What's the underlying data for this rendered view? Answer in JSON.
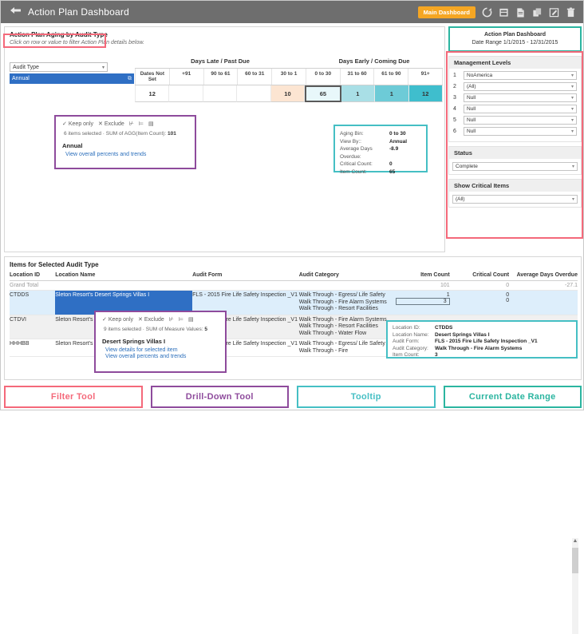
{
  "header": {
    "title": "Action Plan Dashboard",
    "back_icon": "back-arrow-icon",
    "main_dashboard_label": "Main Dashboard",
    "icons": [
      "refresh-icon",
      "save-icon",
      "document-icon",
      "share-icon",
      "edit-icon",
      "trash-icon"
    ]
  },
  "upper": {
    "title": "Action Plan Aging by Audit Type",
    "subtitle": "Click on row or value to filter Action Plan details below.",
    "audit_type_filter": "Audit Type",
    "selected_row": "Annual",
    "group_left": "Days Late / Past Due",
    "group_right": "Days Early / Coming Due",
    "columns": [
      "Dates Not Set",
      "+91",
      "90 to 61",
      "60 to 31",
      "30 to 1",
      "0 to 30",
      "31 to 60",
      "61 to 90",
      "91+"
    ],
    "values": [
      "12",
      "",
      "",
      "",
      "10",
      "65",
      "1",
      "1",
      "12"
    ],
    "cell_colors": [
      "#ffffff",
      "#ffffff",
      "#ffffff",
      "#ffffff",
      "#fce5d2",
      "#e8f7fa",
      "#a9dfe6",
      "#6dcbd7",
      "#3fbecd"
    ],
    "selected_index": 5
  },
  "drill_upper": {
    "keep_only": "Keep only",
    "exclude": "Exclude",
    "meta_prefix": "6 items selected  ·  SUM of AGG(Item Count): ",
    "meta_value": "101",
    "name": "Annual",
    "link": "View overall percents and trends",
    "icons": [
      "keep-only-check-icon",
      "exclude-x-icon",
      "sort-ascending-icon",
      "sort-descending-icon",
      "view-data-icon"
    ]
  },
  "tooltip_upper": {
    "rows": [
      {
        "key": "Aging Bin:",
        "value": "0 to 30"
      },
      {
        "key": "View By::",
        "value": "Annual"
      },
      {
        "key": "Average Days Overdue:",
        "value": "-8.9"
      },
      {
        "key": "Critical Count:",
        "value": "0"
      },
      {
        "key": "Item Count:",
        "value": "65"
      }
    ]
  },
  "right_panel": {
    "date_title": "Action Plan Dashboard",
    "date_range": "Date Range 1/1/2015 - 12/31/2015",
    "management_levels_title": "Management Levels",
    "levels": [
      {
        "num": "1",
        "value": "NoAmerica"
      },
      {
        "num": "2",
        "value": "(All)"
      },
      {
        "num": "3",
        "value": "Null"
      },
      {
        "num": "4",
        "value": "Null"
      },
      {
        "num": "5",
        "value": "Null"
      },
      {
        "num": "6",
        "value": "Null"
      }
    ],
    "status_title": "Status",
    "status_value": "Complete",
    "critical_title": "Show Critical Items",
    "critical_value": "(All)"
  },
  "lower": {
    "title": "Items for Selected Audit Type",
    "columns": [
      "Location ID",
      "Location Name",
      "Audit Form",
      "Audit Category",
      "Item Count",
      "Critical Count",
      "Average Days Overdue"
    ],
    "grand_total": {
      "label": "Grand Total",
      "item_count": "101",
      "critical_count": "0",
      "avg_days": "-27.1"
    },
    "rows": [
      {
        "location_id": "CTDDS",
        "location_name": "Sleton Resort's Desert Springs Villas I",
        "audit_form": "FLS - 2015 Fire Life Safety Inspection _V1",
        "categories": [
          "Walk Through - Egress/ Life Safety",
          "Walk Through - Fire Alarm Systems",
          "Walk Through - Resort Facilities"
        ],
        "item_counts": [
          "1",
          "3",
          ""
        ],
        "critical_counts": [
          "0",
          "0",
          ""
        ],
        "avg_days": [
          "",
          "",
          ""
        ]
      },
      {
        "location_id": "CTDVI",
        "location_name": "Sleton Resort's Desert Springs Villas II",
        "audit_form": "FLS - 2015 Fire Life Safety Inspection _V1",
        "categories": [
          "Walk Through - Fire Alarm Systems",
          "Walk Through - Resort Facilities",
          "Walk Through - Water Flow"
        ],
        "item_counts": [
          "",
          "",
          ""
        ],
        "critical_counts": [
          "",
          "",
          ""
        ],
        "avg_days": [
          "",
          "",
          ""
        ]
      },
      {
        "location_id": "HHHBB",
        "location_name": "Sleton Resort's Barony Beach Club",
        "audit_form": "FLS - 2015 Fire Life Safety Inspection _V1",
        "categories": [
          "Walk Through - Egress/ Life Safety",
          "Walk Through - Fire"
        ],
        "item_counts": [
          "",
          ""
        ],
        "critical_counts": [
          "",
          ""
        ],
        "avg_days": [
          "",
          ""
        ]
      }
    ]
  },
  "drill_lower": {
    "keep_only": "Keep only",
    "exclude": "Exclude",
    "meta_prefix": "9 items selected  ·  SUM of Measure Values: ",
    "meta_value": "5",
    "name": "Desert Springs Villas I",
    "link1": "View details for selected item",
    "link2": "View overall percents and trends"
  },
  "tooltip_lower": {
    "rows": [
      {
        "key": "Location ID:",
        "value": "CTDDS"
      },
      {
        "key": "Location Name:",
        "value": "Desert Springs Villas I"
      },
      {
        "key": "Audit Form:",
        "value": "FLS - 2015 Fire Life Safety Inspection _V1"
      },
      {
        "key": "Audit Category:",
        "value": "Walk Through - Fire Alarm Systems"
      },
      {
        "key": "Item Count:",
        "value": "3"
      }
    ]
  },
  "legend": [
    {
      "label": "Filter Tool",
      "color": "#f4697a"
    },
    {
      "label": "Drill-Down Tool",
      "color": "#8e4b9c"
    },
    {
      "label": "Tooltip",
      "color": "#45bfc4"
    },
    {
      "label": "Current Date Range",
      "color": "#2bb5a0"
    }
  ]
}
